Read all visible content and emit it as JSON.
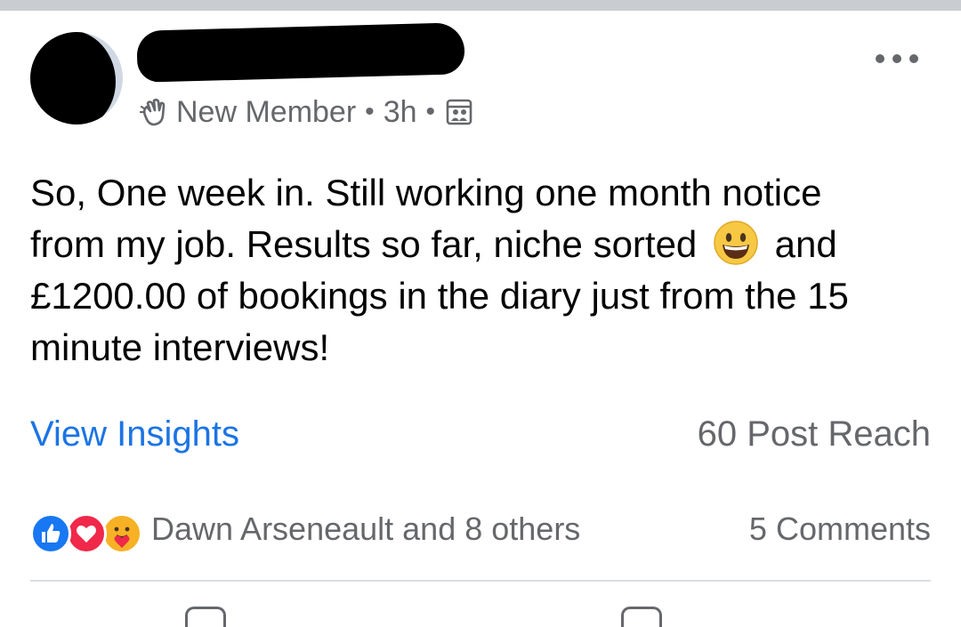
{
  "post": {
    "author": {
      "badge": "New Member",
      "time": "3h",
      "avatar_icon": "redacted-avatar",
      "name_icon": "redacted-name"
    },
    "text": {
      "line1": "So, One week in. Still working one month notice",
      "line2_before": "from my job. Results so far, niche sorted",
      "emoji": "grinning-face",
      "line2_after": "and",
      "line3": "£1200.00 of bookings in the diary just from the 15",
      "line4": "minute interviews!"
    },
    "insights_link": "View Insights",
    "reach": "60 Post Reach",
    "reactions": {
      "icons": [
        "like-icon",
        "love-icon",
        "care-icon"
      ],
      "names": "Dawn Arseneault and 8 others"
    },
    "comments": "5 Comments"
  },
  "colors": {
    "link": "#1b74e4",
    "secondary_text": "#65676b",
    "like": "#1877f2",
    "love": "#f02849",
    "care": "#f7b125"
  }
}
